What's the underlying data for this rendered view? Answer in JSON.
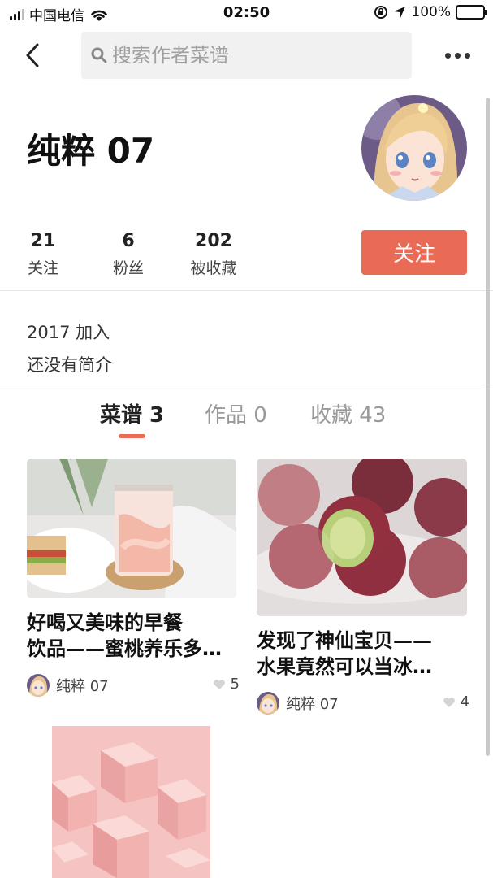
{
  "status_bar": {
    "carrier": "中国电信",
    "time": "02:50",
    "battery": "100%"
  },
  "nav": {
    "search_placeholder": "搜索作者菜谱"
  },
  "profile": {
    "name": "纯粹 07",
    "stats": [
      {
        "value": "21",
        "label": "关注"
      },
      {
        "value": "6",
        "label": "粉丝"
      },
      {
        "value": "202",
        "label": "被收藏"
      }
    ],
    "follow_label": "关注",
    "joined": "2017 加入",
    "bio": "还没有简介"
  },
  "tabs": [
    {
      "label": "菜谱 3",
      "active": true
    },
    {
      "label": "作品 0",
      "active": false
    },
    {
      "label": "收藏 43",
      "active": false
    }
  ],
  "recipes": [
    {
      "title_line1": "好喝又美味的早餐",
      "title_line2": "饮品——蜜桃养乐多…",
      "author": "纯粹 07",
      "likes": "5"
    },
    {
      "title_line1": "发现了神仙宝贝——",
      "title_line2": "水果竟然可以当冰…",
      "author": "纯粹 07",
      "likes": "4"
    }
  ],
  "colors": {
    "accent": "#ea6b55",
    "battery": "#4cd964"
  }
}
